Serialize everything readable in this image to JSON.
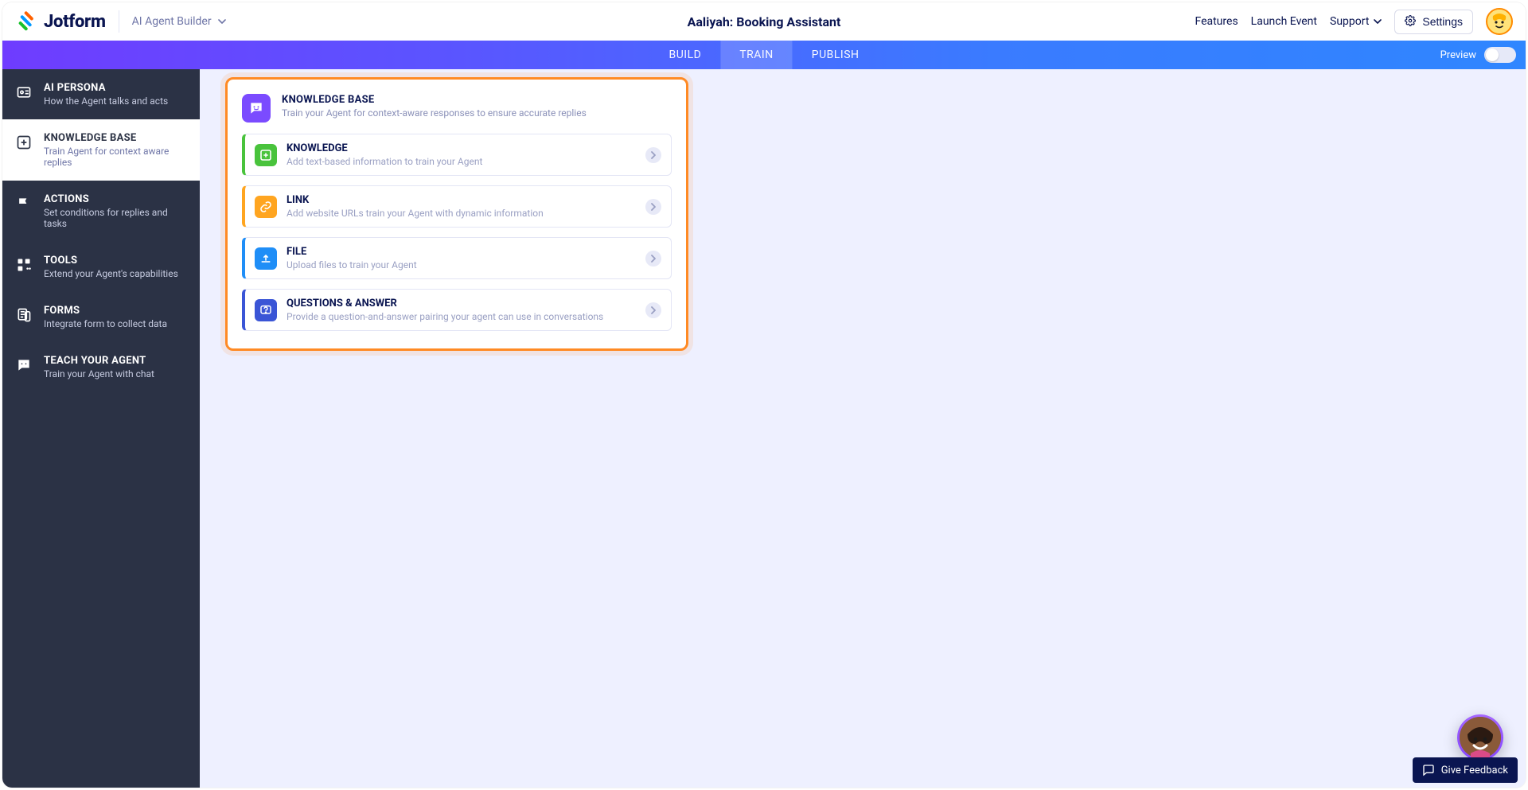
{
  "header": {
    "logo_text": "Jotform",
    "brand_sub": "AI Agent Builder",
    "page_title": "Aaliyah: Booking Assistant",
    "nav": {
      "features": "Features",
      "launch": "Launch Event",
      "support": "Support"
    },
    "settings_label": "Settings"
  },
  "tabs": {
    "build": "BUILD",
    "train": "TRAIN",
    "publish": "PUBLISH",
    "preview_label": "Preview"
  },
  "sidebar": {
    "items": [
      {
        "title": "AI PERSONA",
        "desc": "How the Agent talks and acts"
      },
      {
        "title": "KNOWLEDGE BASE",
        "desc": "Train Agent for context aware replies"
      },
      {
        "title": "ACTIONS",
        "desc": "Set conditions for replies and tasks"
      },
      {
        "title": "TOOLS",
        "desc": "Extend your Agent's capabilities"
      },
      {
        "title": "FORMS",
        "desc": "Integrate form to collect data"
      },
      {
        "title": "TEACH YOUR AGENT",
        "desc": "Train your Agent with chat"
      }
    ]
  },
  "panel": {
    "title": "KNOWLEDGE BASE",
    "desc": "Train your Agent for context-aware responses to ensure accurate replies",
    "cards": [
      {
        "title": "KNOWLEDGE",
        "desc": "Add text-based information to train your Agent"
      },
      {
        "title": "LINK",
        "desc": "Add website URLs train your Agent with dynamic information"
      },
      {
        "title": "FILE",
        "desc": "Upload files to train your Agent"
      },
      {
        "title": "QUESTIONS & ANSWER",
        "desc": "Provide a question-and-answer pairing your agent can use in conversations"
      }
    ]
  },
  "feedback": {
    "label": "Give Feedback"
  }
}
